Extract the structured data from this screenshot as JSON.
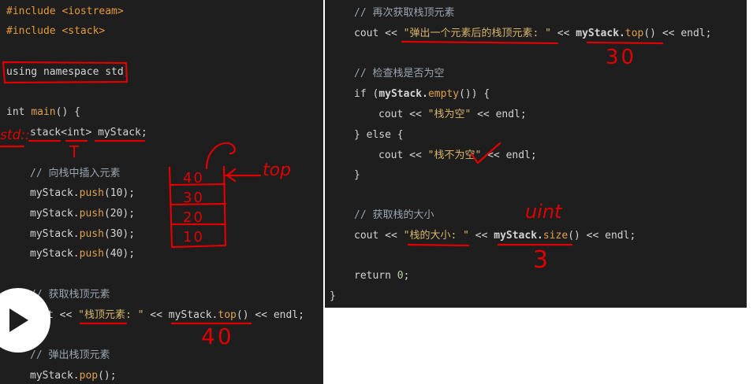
{
  "left_code": {
    "include_iostream": "#include <iostream>",
    "include_stack": "#include <stack>",
    "using_namespace": "using namespace std;",
    "main_int": "int",
    "main_name": "main",
    "main_paren": "() {",
    "stack_decl": "stack<int> myStack;",
    "comment_push": "// 向栈中插入元素",
    "push_10_a": "myStack.",
    "push_fn": "push",
    "push_10_arg": "(10);",
    "push_20_arg": "(20);",
    "push_30_arg": "(30);",
    "push_40_arg": "(40);",
    "comment_top": "// 获取栈顶元素",
    "cout_top_a": "t << ",
    "cout_top_str": "\"栈顶元素: \"",
    "cout_top_b": " << ",
    "cout_top_obj": "myStack.",
    "top_fn": "top",
    "cout_top_c": "() << endl;",
    "comment_pop": "// 弹出栈顶元素",
    "pop_obj": "myStack.",
    "pop_fn": "pop",
    "pop_tail": "();"
  },
  "right_code": {
    "comment_again": "// 再次获取栈顶元素",
    "cout_a": "cout << ",
    "again_str": "\"弹出一个元素后的栈顶元素: \"",
    "shift": " << ",
    "obj": "myStack.",
    "top_fn": "top",
    "tail_endl": "() << endl;",
    "comment_empty": "// 检查栈是否为空",
    "if_a": "if (",
    "empty_fn": "empty",
    "if_b": "()) {",
    "empty_str": "\"栈为空\"",
    "endl_tail": " << endl;",
    "else_line": "} else {",
    "notempty_str": "\"栈不为空\"",
    "close_brace": "}",
    "comment_size": "// 获取栈的大小",
    "size_str": "\"栈的大小: \"",
    "size_fn": "size",
    "return_kw": "return ",
    "return_val": "0",
    "return_semi": ";",
    "final_brace": "}"
  },
  "annotations": {
    "stack_cells": [
      "40",
      "30",
      "20",
      "10"
    ],
    "top_label": "top",
    "std_mark": "std::",
    "t_mark": "T",
    "val_40": "40",
    "val_30": "30",
    "uint_label": "uint",
    "val_3": "3"
  },
  "colors": {
    "editor_bg": "#1e1e1e",
    "ink": "#e00000",
    "preprocessor": "#e59a3b",
    "string": "#d8b46c",
    "function": "#e0a14f"
  },
  "icons": {
    "play": "play-icon"
  }
}
